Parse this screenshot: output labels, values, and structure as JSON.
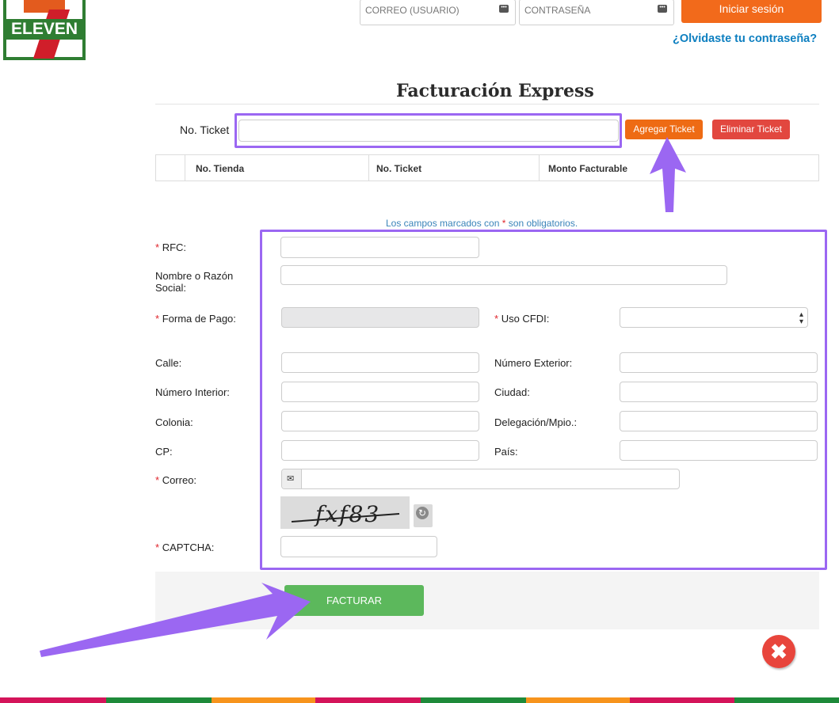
{
  "header": {
    "logo_text": "ELEVEN",
    "login": {
      "user_placeholder": "CORREO (USUARIO)",
      "password_placeholder": "CONTRASEÑA",
      "login_label": "Iniciar sesión",
      "forgot_label": "¿Olvidaste tu contraseña?"
    }
  },
  "page": {
    "title": "Facturación Express"
  },
  "ticket": {
    "label": "No. Ticket",
    "value": "",
    "add_label": "Agregar Ticket",
    "remove_label": "Eliminar Ticket",
    "table_headers": [
      "No. Tienda",
      "No. Ticket",
      "Monto Facturable"
    ]
  },
  "form": {
    "notice_before": "Los campos marcados con",
    "notice_star": "*",
    "notice_after": "son obligatorios.",
    "rfc_label": "RFC:",
    "nombre_label": "Nombre o Razón Social:",
    "forma_pago_label": "Forma de Pago:",
    "uso_cfdi_label": "Uso CFDI:",
    "calle_label": "Calle:",
    "num_ext_label": "Número Exterior:",
    "num_int_label": "Número Interior:",
    "ciudad_label": "Ciudad:",
    "colonia_label": "Colonia:",
    "delegacion_label": "Delegación/Mpio.:",
    "cp_label": "CP:",
    "pais_label": "País:",
    "correo_label": "Correo:",
    "captcha_text": "fxf83",
    "captcha_label": "CAPTCHA:",
    "required_star": "*"
  },
  "actions": {
    "facturar_label": "FACTURAR"
  },
  "colors": {
    "accent_orange": "#ee6b14",
    "danger_red": "#e2473f",
    "success_green": "#5cb85c",
    "highlight_purple": "#9b67f2",
    "link_blue": "#0d7fc0"
  },
  "footer_stripes": [
    "#d4145a",
    "#1e8a3a",
    "#f7941d",
    "#d4145a",
    "#1e8a3a",
    "#f7941d",
    "#d4145a",
    "#1e8a3a"
  ]
}
